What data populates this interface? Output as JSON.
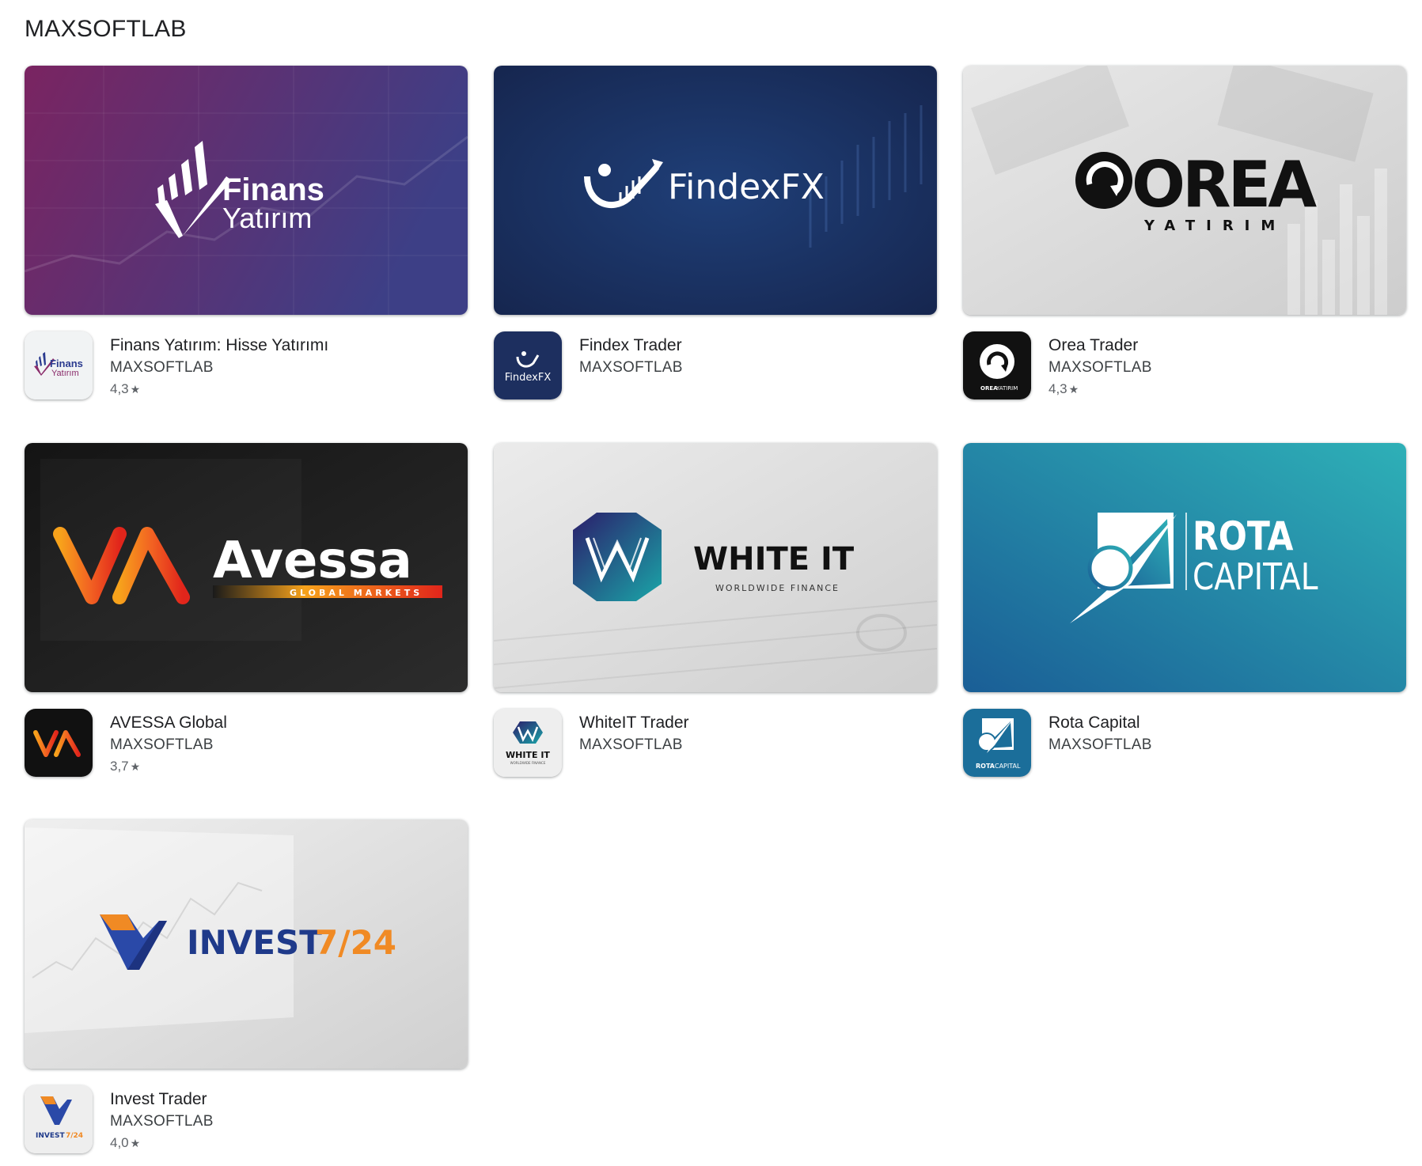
{
  "page": {
    "title": "MAXSOFTLAB"
  },
  "apps": [
    {
      "title": "Finans Yatırım: Hisse Yatırımı",
      "developer": "MAXSOFTLAB",
      "rating": "4,3",
      "banner": {
        "line1": "Finans",
        "line2": "Yatırım",
        "colors": [
          "#7a2461",
          "#3d3f86"
        ]
      },
      "icon": {
        "line1": "Finans",
        "line2": "Yatırım",
        "colors": [
          "#f1f3f4"
        ]
      }
    },
    {
      "title": "Findex Trader",
      "developer": "MAXSOFTLAB",
      "rating": "",
      "banner": {
        "line1": "FindexFX",
        "colors": [
          "#1b2d5e",
          "#1f3f78"
        ]
      },
      "icon": {
        "line1": "FindexFX",
        "colors": [
          "#1d2f5f"
        ]
      }
    },
    {
      "title": "Orea Trader",
      "developer": "MAXSOFTLAB",
      "rating": "4,3",
      "banner": {
        "line1": "OREA",
        "line2": "YATIRIM",
        "colors": [
          "#e8e8e8",
          "#cfcfcf"
        ]
      },
      "icon": {
        "line1": "OREA",
        "line2": "YATIRIM",
        "colors": [
          "#111111"
        ]
      }
    },
    {
      "title": "AVESSA Global",
      "developer": "MAXSOFTLAB",
      "rating": "3,7",
      "banner": {
        "line1": "Avessa",
        "line2": "GLOBAL MARKETS",
        "colors": [
          "#1a1a1a",
          "#2b2b2b"
        ]
      },
      "icon": {
        "colors": [
          "#111111"
        ]
      }
    },
    {
      "title": "WhiteIT Trader",
      "developer": "MAXSOFTLAB",
      "rating": "",
      "banner": {
        "line1": "WHITE IT",
        "line2": "WORLDWIDE FINANCE",
        "colors": [
          "#e6e6e6",
          "#cfcfcf"
        ]
      },
      "icon": {
        "line1": "WHITE IT",
        "line2": "WORLDWIDE FINANCE",
        "colors": [
          "#eeeeee"
        ]
      }
    },
    {
      "title": "Rota Capital",
      "developer": "MAXSOFTLAB",
      "rating": "",
      "banner": {
        "line1": "ROTA",
        "line2": "CAPITAL",
        "colors": [
          "#1a5e96",
          "#2eaab5"
        ]
      },
      "icon": {
        "line1": "ROTA",
        "line2": "CAPITAL",
        "colors": [
          "#1b6e9a"
        ]
      }
    },
    {
      "title": "Invest Trader",
      "developer": "MAXSOFTLAB",
      "rating": "4,0",
      "banner": {
        "line1": "INVEST",
        "line2": "7/24",
        "colors": [
          "#ececec",
          "#d2d2d2"
        ]
      },
      "icon": {
        "line1": "INVEST",
        "line2": "7/24",
        "colors": [
          "#eeeeee"
        ]
      }
    }
  ]
}
